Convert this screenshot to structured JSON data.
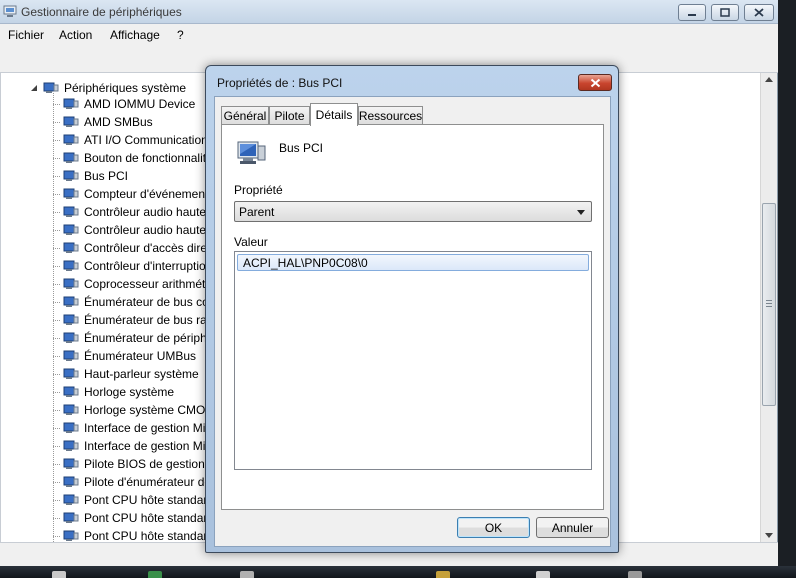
{
  "window": {
    "title": "Gestionnaire de périphériques",
    "menu": [
      "Fichier",
      "Action",
      "Affichage",
      "?"
    ]
  },
  "tree": {
    "root_label": "Périphériques système",
    "items": [
      "AMD IOMMU Device",
      "AMD SMBus",
      "ATI I/O Communication",
      "Bouton de fonctionnalit",
      "Bus PCI",
      "Compteur d'événement",
      "Contrôleur audio haute",
      "Contrôleur audio haute",
      "Contrôleur d'accès dire",
      "Contrôleur d'interruptio",
      "Coprocesseur arithméti",
      "Énumérateur de bus com",
      "Énumérateur de bus rac",
      "Énumérateur de périphe",
      "Énumérateur UMBus",
      "Haut-parleur système",
      "Horloge système",
      "Horloge système CMOS",
      "Interface de gestion Mic",
      "Interface de gestion Mic",
      "Pilote BIOS de gestion d",
      "Pilote d'énumérateur de",
      "Pont CPU hôte standard",
      "Pont CPU hôte standard",
      "Pont CPU hôte standard"
    ]
  },
  "dialog": {
    "title": "Propriétés de : Bus PCI",
    "tabs": [
      "Général",
      "Pilote",
      "Détails",
      "Ressources"
    ],
    "active_tab": "Détails",
    "device_name": "Bus PCI",
    "property_label": "Propriété",
    "property_value": "Parent",
    "value_label": "Valeur",
    "values": [
      "ACPI_HAL\\PNP0C08\\0"
    ],
    "ok_label": "OK",
    "cancel_label": "Annuler"
  },
  "colors": {
    "dialog_frame": "#a9c1dd",
    "close_button": "#c9452e",
    "selection": "#dbe8f9",
    "device_icon_blue": "#3a6fc4"
  },
  "icons": {
    "title": "device-manager-icon",
    "tree_item": "device-icon",
    "expander": "collapse-triangle-icon",
    "dialog_device": "pci-bus-icon",
    "close": "close-x-icon",
    "dropdown": "chevron-down-icon"
  }
}
